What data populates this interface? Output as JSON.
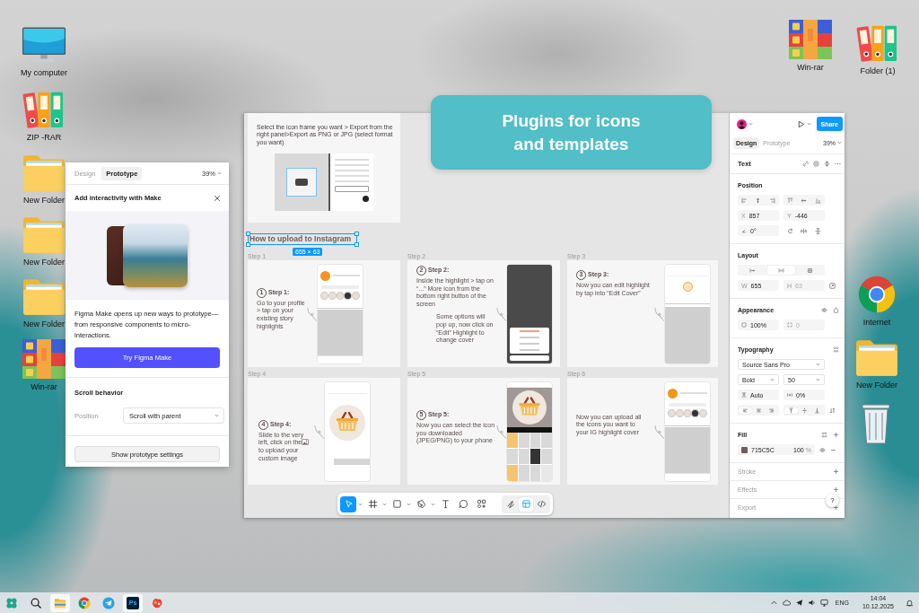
{
  "desktop": {
    "left_icons": [
      {
        "kind": "computer",
        "label": "My computer"
      },
      {
        "kind": "binders",
        "label": "ZIP -RAR"
      },
      {
        "kind": "folder",
        "label": "New Folder"
      },
      {
        "kind": "folder",
        "label": "New Folder"
      },
      {
        "kind": "folder",
        "label": "New Folder"
      },
      {
        "kind": "archive",
        "label": "Win-rar"
      }
    ],
    "right_icons": [
      {
        "kind": "archive",
        "label": "Win-rar"
      },
      {
        "kind": "binders",
        "label": "Folder (1)"
      },
      {
        "kind": "browser",
        "label": "Internet"
      },
      {
        "kind": "folder",
        "label": "New Folder"
      },
      {
        "kind": "trash"
      }
    ]
  },
  "banner": {
    "text": "Plugins for icons and templates"
  },
  "prototype_panel": {
    "tabs": [
      {
        "label": "Design",
        "selected": false
      },
      {
        "label": "Prototype",
        "selected": true
      }
    ],
    "zoom": "39%",
    "title": "Add interactivity with Make",
    "description": "Figma Make opens up new ways to prototype—from responsive components to micro-interactions.",
    "primary_button": "Try Figma Make",
    "section_title": "Scroll behavior",
    "position": {
      "label": "Position",
      "value": "Scroll with parent"
    },
    "settings_button": "Show prototype settings"
  },
  "canvas": {
    "export_note": "Select the icon frame you want > Export from the right panel>Export as PNG or JPG (select format you want)",
    "heading": {
      "text": "How to upload to Instagram",
      "selected": true
    },
    "size_badge": "655 × 63",
    "steps": [
      {
        "label": "Step 1",
        "number": "1",
        "title": "Step 1:",
        "text": "Go to your profile > tap on your existing story highlights",
        "phone": {
          "kind": "profile"
        }
      },
      {
        "label": "Step 2",
        "number": "2",
        "title": "Step 2:",
        "text": "Inside the highlight > tap on “...” More icon from the bottom right button of the screen",
        "note": "Some options will pop up, now click on “Edit” Highlight to change cover",
        "phone": {
          "kind": "menu"
        }
      },
      {
        "label": "Step 3",
        "number": "3",
        "title": "Step 3:",
        "text": "Now you can edit highlight by tap into “Edit Cover”",
        "phone": {
          "kind": "highlight"
        }
      },
      {
        "label": "Step 4",
        "number": "4",
        "title": "Step 4:",
        "text": "Slide to the very left, click on the",
        "text_after": "to upload your custom image",
        "phone": {
          "kind": "cover"
        }
      },
      {
        "label": "Step 5",
        "number": "5",
        "title": "Step 5:",
        "text": "Now you can select the icon you downloaded (JPEG/PNG) to your phone",
        "phone": {
          "kind": "library"
        }
      },
      {
        "label": "Step 6",
        "text": "Now you can upload all the icons you want to your IG highlight cover",
        "phone": {
          "kind": "profile"
        }
      }
    ],
    "toolbar": {
      "tools": [
        {
          "kind": "move",
          "selected": true,
          "menu": true
        },
        {
          "kind": "frame",
          "selected": false,
          "menu": true
        },
        {
          "kind": "shape",
          "selected": false,
          "menu": true
        },
        {
          "kind": "pen",
          "selected": false,
          "menu": true
        },
        {
          "kind": "text",
          "selected": false,
          "menu": false
        },
        {
          "kind": "comment",
          "selected": false,
          "menu": false
        },
        {
          "kind": "assets",
          "selected": false,
          "menu": false
        }
      ],
      "modes": [
        {
          "kind": "draw",
          "selected": false
        },
        {
          "kind": "design",
          "selected": true
        },
        {
          "kind": "dev",
          "selected": false
        }
      ]
    }
  },
  "design_panel": {
    "share_button": "Share",
    "tabs": [
      {
        "label": "Design",
        "selected": true
      },
      {
        "label": "Prototype",
        "selected": false
      }
    ],
    "zoom": "39%",
    "layer_type": "Text",
    "position": {
      "title": "Position",
      "x": {
        "label": "X",
        "value": "857"
      },
      "y": {
        "label": "Y",
        "value": "-446"
      },
      "rotation": "0°"
    },
    "layout": {
      "title": "Layout",
      "modes": [
        {
          "kind": "auto_width",
          "selected": false
        },
        {
          "kind": "auto_height",
          "selected": true
        },
        {
          "kind": "fixed",
          "selected": false
        }
      ],
      "width": {
        "label": "W",
        "value": "655",
        "disabled": false
      },
      "height": {
        "label": "H",
        "value": "63",
        "disabled": true
      }
    },
    "appearance": {
      "title": "Appearance",
      "opacity": "100%",
      "radius": {
        "value": "0",
        "disabled": true
      }
    },
    "typography": {
      "title": "Typography",
      "font": "Source Sans Pro",
      "weight": "Bold",
      "size": "50",
      "line_height": "Auto",
      "letter_spacing": "0%",
      "align": [
        {
          "kind": "left",
          "selected": true
        },
        {
          "kind": "center",
          "selected": false
        },
        {
          "kind": "right",
          "selected": false
        }
      ],
      "vertical_align": [
        {
          "kind": "top",
          "selected": true
        },
        {
          "kind": "middle",
          "selected": false
        },
        {
          "kind": "bottom",
          "selected": false
        }
      ]
    },
    "fill": {
      "title": "Fill",
      "items": [
        {
          "color": "#715c5c",
          "hex": "715C5C",
          "opacity": "100",
          "unit": "%"
        }
      ]
    },
    "collapsed_sections": [
      "Stroke",
      "Effects",
      "Export"
    ],
    "help_button": "?"
  },
  "taskbar": {
    "apps": [
      {
        "kind": "start",
        "open": false
      },
      {
        "kind": "search",
        "open": false
      },
      {
        "kind": "files",
        "open": true
      },
      {
        "kind": "browser",
        "open": false
      },
      {
        "kind": "messenger",
        "open": false
      },
      {
        "kind": "editor",
        "label": "Ps",
        "open": true
      },
      {
        "kind": "blob",
        "open": false
      }
    ],
    "tray": {
      "language": "ENG",
      "time": "14:04",
      "date": "10.12.2025"
    }
  }
}
